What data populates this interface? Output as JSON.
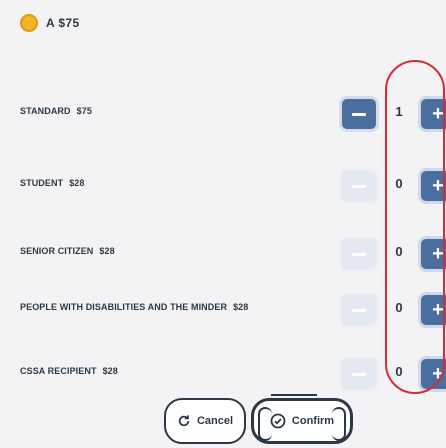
{
  "header": {
    "balance": "A $75",
    "coin_color": "#f0b429"
  },
  "tickets": [
    {
      "label": "STANDARD",
      "price": "$75",
      "quantity": "1",
      "minus_enabled": true
    },
    {
      "label": "STUDENT",
      "price": "$28",
      "quantity": "0",
      "minus_enabled": false
    },
    {
      "label": "SENIOR CITIZEN",
      "price": "$28",
      "quantity": "0",
      "minus_enabled": false
    },
    {
      "label": "PEOPLE WITH DISABILITIES AND THE MINDER",
      "price": "$28",
      "quantity": "0",
      "minus_enabled": false
    },
    {
      "label": "CSSA RECIPIENT",
      "price": "$28",
      "quantity": "0",
      "minus_enabled": false
    }
  ],
  "buttons": {
    "cancel_label": "Cancel",
    "confirm_label": "Confirm"
  },
  "colors": {
    "accent": "#4a6f9e",
    "highlight": "#d82a33",
    "text": "#2b3947"
  },
  "icons": {
    "minus": "minus-icon",
    "plus": "plus-icon",
    "cancel": "refresh-icon",
    "confirm": "check-circle-icon"
  }
}
